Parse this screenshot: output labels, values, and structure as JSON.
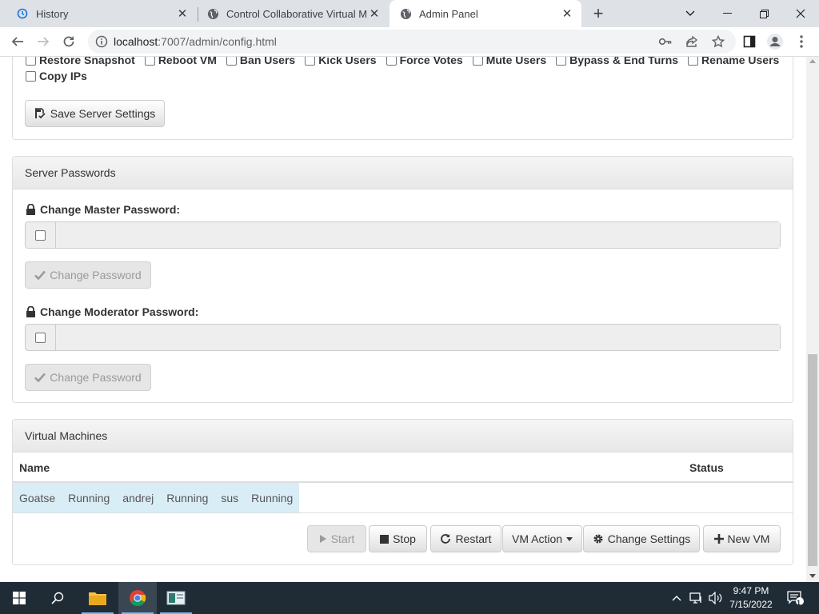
{
  "browser": {
    "tabs": [
      {
        "label": "History",
        "icon": "history-icon",
        "active": false
      },
      {
        "label": "Control Collaborative Virtual Mac",
        "icon": "globe-icon",
        "active": false
      },
      {
        "label": "Admin Panel",
        "icon": "globe-icon",
        "active": true
      }
    ],
    "url_host": "localhost",
    "url_path": ":7007/admin/config.html"
  },
  "permissions": {
    "partial_row": [
      "Restore Snapshot",
      "Reboot VM",
      "Ban Users",
      "Kick Users",
      "Force Votes",
      "Mute Users",
      "Bypass & End Turns",
      "Rename Users"
    ],
    "copy_ips": "Copy IPs"
  },
  "server_settings": {
    "save_label": "Save Server Settings"
  },
  "passwords": {
    "heading": "Server Passwords",
    "master_label": "Change Master Password:",
    "moderator_label": "Change Moderator Password:",
    "change_button": "Change Password"
  },
  "vms": {
    "heading": "Virtual Machines",
    "columns": [
      "Name",
      "Status"
    ],
    "row_cells": [
      "Goatse",
      "Running",
      "andrej",
      "Running",
      "sus",
      "Running"
    ],
    "actions": {
      "start": "Start",
      "stop": "Stop",
      "restart": "Restart",
      "vm_action": "VM Action",
      "change_settings": "Change Settings",
      "new_vm": "New VM"
    }
  },
  "taskbar": {
    "time": "9:47 PM",
    "date": "7/15/2022",
    "notification_count": "1"
  }
}
